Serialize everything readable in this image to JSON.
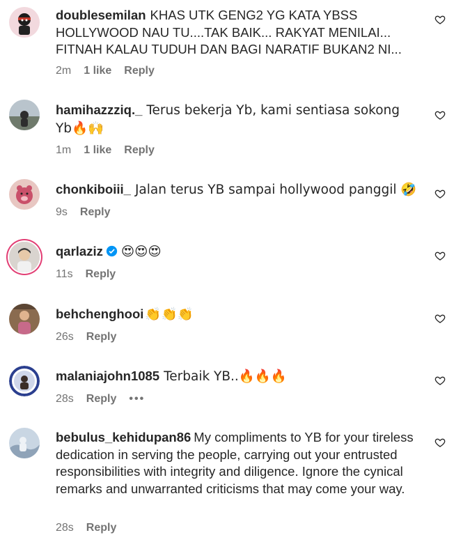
{
  "comments": [
    {
      "username": "doublesemilan",
      "text": "KHAS UTK GENG2 YG KATA YBSS HOLLYWOOD NAU TU....TAK BAIK... RAKYAT MENILAI... FITNAH KALAU TUDUH DAN BAGI NARATIF BUKAN2 NI...",
      "time": "2m",
      "likes": "1 like",
      "reply": "Reply"
    },
    {
      "username": "hamihazzziq._",
      "text": "Terus bekerja Yb, kami sentiasa sokong Yb🔥🙌",
      "time": "1m",
      "likes": "1 like",
      "reply": "Reply"
    },
    {
      "username": "chonkiboiii_",
      "text": "Jalan terus YB sampai hollywood panggil 🤣",
      "time": "9s",
      "reply": "Reply"
    },
    {
      "username": "qarlaziz",
      "text": "😍😍😍",
      "time": "11s",
      "reply": "Reply"
    },
    {
      "username": "behchenghooi",
      "text": "👏👏👏",
      "time": "26s",
      "reply": "Reply"
    },
    {
      "username": "malaniajohn1085",
      "text": "Terbaik YB..🔥🔥🔥",
      "time": "28s",
      "reply": "Reply",
      "more": "•••"
    },
    {
      "username": "bebulus_kehidupan86",
      "text": "My compliments to YB for your tireless dedication in serving the people, carrying out your entrusted responsibilities with integrity and diligence. Ignore the cynical remarks and unwarranted criticisms that may come your way.",
      "time": "28s",
      "reply": "Reply"
    }
  ],
  "colors": {
    "text": "#262626",
    "secondary": "#737373",
    "verified": "#0095f6",
    "story_ring": "#e23e74"
  },
  "icons": {
    "like": "heart-outline-icon",
    "verified": "verified-badge-icon"
  }
}
